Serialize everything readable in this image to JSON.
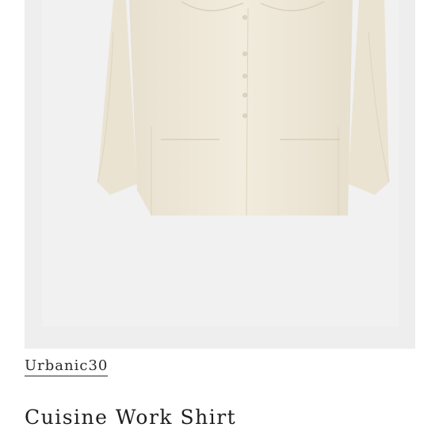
{
  "product": {
    "brand": "Urbanic30",
    "title": "Cuisine Work Shirt"
  },
  "gallery": {
    "image_subject": "cream-work-shirt",
    "next_icon": "chevron-right-icon"
  },
  "colors": {
    "gallery_bg": "#eeeeef",
    "shirt": "#efe8d8",
    "text": "#1e1e1e"
  }
}
